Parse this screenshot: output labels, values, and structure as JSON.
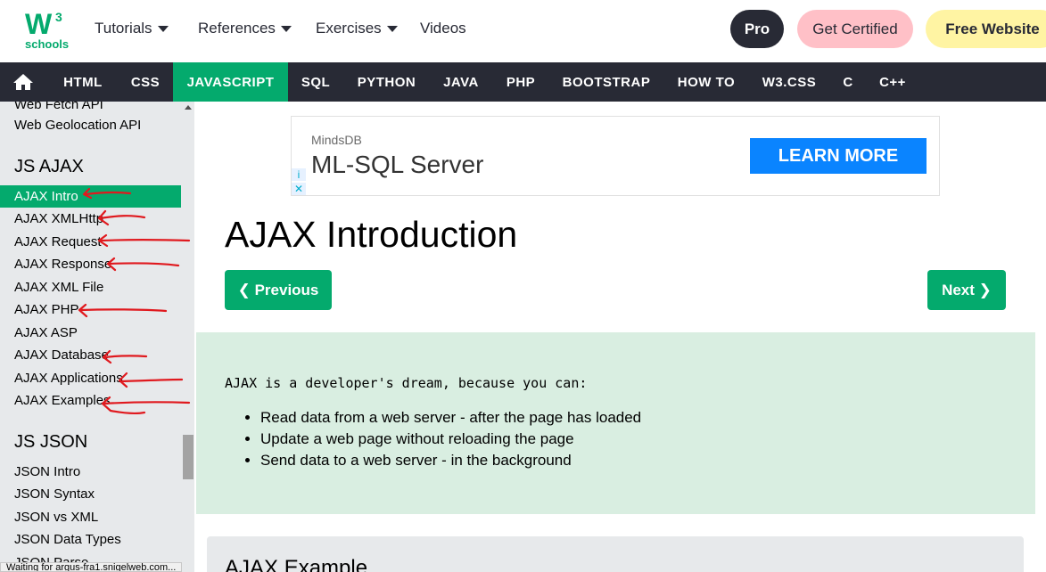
{
  "logo": {
    "text": "schools",
    "superscript": "3",
    "color": "#04aa6d"
  },
  "topnav": {
    "tutorials": "Tutorials",
    "references": "References",
    "exercises": "Exercises",
    "videos": "Videos",
    "pro": "Pro",
    "get_certified": "Get Certified",
    "free_website": "Free Website"
  },
  "technav": {
    "home_icon": "home-icon",
    "items": [
      "HTML",
      "CSS",
      "JAVASCRIPT",
      "SQL",
      "PYTHON",
      "JAVA",
      "PHP",
      "BOOTSTRAP",
      "HOW TO",
      "W3.CSS",
      "C",
      "C++"
    ],
    "active": "JAVASCRIPT"
  },
  "sidebar": {
    "top_links": [
      "Web Fetch API",
      "Web Geolocation API"
    ],
    "ajax_heading": "JS AJAX",
    "ajax_links": [
      "AJAX Intro",
      "AJAX XMLHttp",
      "AJAX Request",
      "AJAX Response",
      "AJAX XML File",
      "AJAX PHP",
      "AJAX ASP",
      "AJAX Database",
      "AJAX Applications",
      "AJAX Examples"
    ],
    "active": "AJAX Intro",
    "json_heading": "JS JSON",
    "json_links": [
      "JSON Intro",
      "JSON Syntax",
      "JSON vs XML",
      "JSON Data Types",
      "JSON Parse"
    ]
  },
  "ad": {
    "brand": "MindsDB",
    "title": "ML-SQL Server",
    "cta": "LEARN MORE",
    "info": "i",
    "close": "✕"
  },
  "main": {
    "title": "AJAX Introduction",
    "prev": "❮ Previous",
    "next": "Next ❯",
    "intro": "AJAX is a developer's dream, because you can:",
    "bullets": [
      "Read data from a web server - after the page has loaded",
      "Update a web page without reloading the page",
      "Send data to a web server - in the background"
    ],
    "example_title": "AJAX Example"
  },
  "status": "Waiting for argus-fra1.snigelweb.com...",
  "colors": {
    "accent": "#04aa6d",
    "dark": "#282a35",
    "annotation": "#e0191e"
  }
}
